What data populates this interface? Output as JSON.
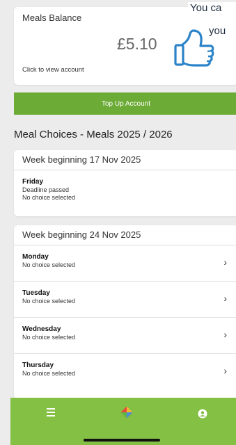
{
  "balance": {
    "title": "Meals Balance",
    "amount": "£5.10",
    "link_label": "Click to view account"
  },
  "overlay": {
    "line1": "You ca",
    "line2": "you",
    "thumbs_icon": "thumbs-up-icon"
  },
  "topup_label": "Top Up Account",
  "section_title": "Meal Choices - Meals 2025 / 2026",
  "weeks": [
    {
      "header": "Week beginning 17 Nov 2025",
      "days": [
        {
          "name": "Friday",
          "line1": "Deadline passed",
          "line2": "No choice selected"
        }
      ]
    },
    {
      "header": "Week beginning 24 Nov 2025",
      "days": [
        {
          "name": "Monday",
          "line1": "No choice selected"
        },
        {
          "name": "Tuesday",
          "line1": "No choice selected"
        },
        {
          "name": "Wednesday",
          "line1": "No choice selected"
        },
        {
          "name": "Thursday",
          "line1": "No choice selected"
        }
      ]
    }
  ],
  "nav": {
    "items": [
      "menu-icon",
      "home-icon",
      "profile-icon"
    ]
  },
  "colors": {
    "accent_green": "#6cab36",
    "nav_green": "#84c044",
    "thumbs_blue": "#2b84c9"
  }
}
